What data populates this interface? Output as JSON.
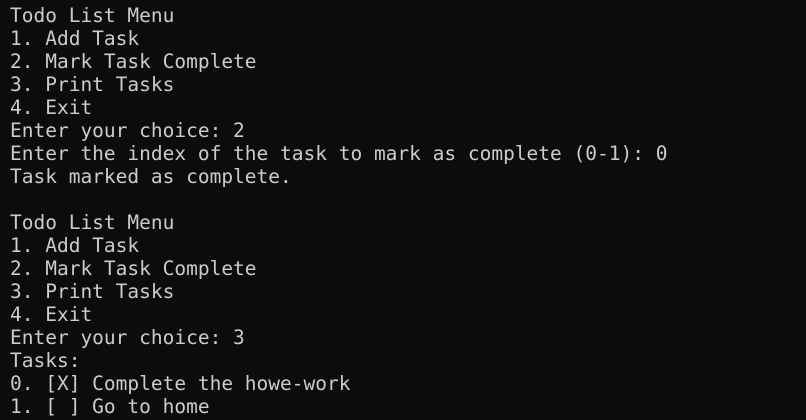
{
  "terminal": {
    "lines": [
      "Todo List Menu",
      "1. Add Task",
      "2. Mark Task Complete",
      "3. Print Tasks",
      "4. Exit",
      "Enter your choice: 2",
      "Enter the index of the task to mark as complete (0-1): 0",
      "Task marked as complete.",
      "",
      "Todo List Menu",
      "1. Add Task",
      "2. Mark Task Complete",
      "3. Print Tasks",
      "4. Exit",
      "Enter your choice: 3",
      "Tasks:",
      "0. [X] Complete the howe-work",
      "1. [ ] Go to home"
    ],
    "colors": {
      "background": "#0c0c0c",
      "foreground": "#cccccc"
    }
  }
}
